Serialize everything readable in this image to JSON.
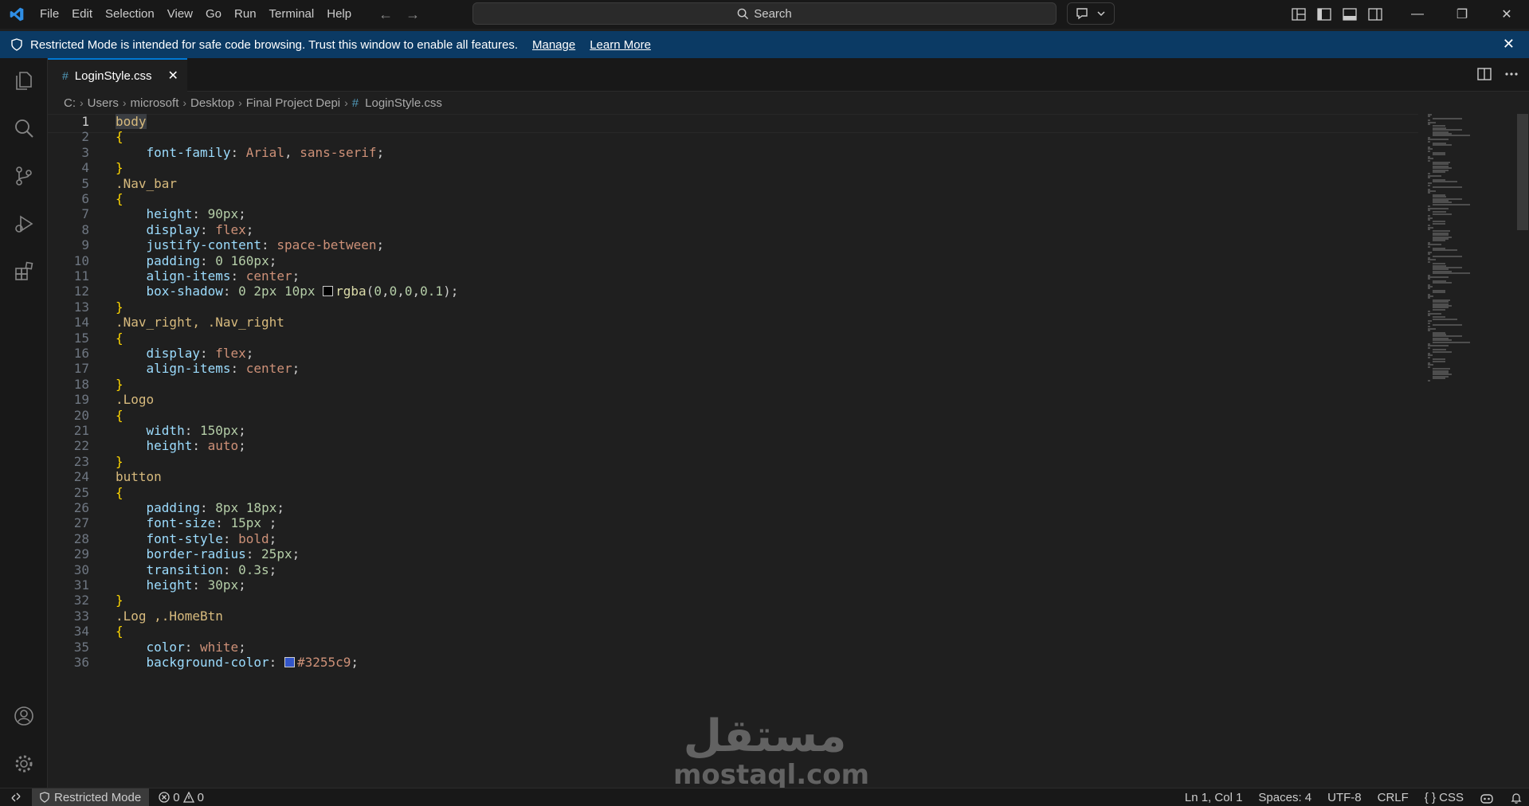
{
  "menu": [
    "File",
    "Edit",
    "Selection",
    "View",
    "Go",
    "Run",
    "Terminal",
    "Help"
  ],
  "search": {
    "label": "Search"
  },
  "banner": {
    "message": "Restricted Mode is intended for safe code browsing. Trust this window to enable all features.",
    "manage": "Manage",
    "learn_more": "Learn More"
  },
  "tab": {
    "hash": "#",
    "title": "LoginStyle.css"
  },
  "breadcrumb": [
    "C:",
    "Users",
    "microsoft",
    "Desktop",
    "Final Project Depi",
    "LoginStyle.css"
  ],
  "editor": {
    "lines": [
      {
        "n": "1",
        "text": "body"
      },
      {
        "n": "2",
        "text": "{"
      },
      {
        "n": "3",
        "text": "    font-family: Arial, sans-serif;"
      },
      {
        "n": "4",
        "text": "}"
      },
      {
        "n": "5",
        "text": ".Nav_bar"
      },
      {
        "n": "6",
        "text": "{"
      },
      {
        "n": "7",
        "text": "    height: 90px;"
      },
      {
        "n": "8",
        "text": "    display: flex;"
      },
      {
        "n": "9",
        "text": "    justify-content: space-between;"
      },
      {
        "n": "10",
        "text": "    padding: 0 160px;"
      },
      {
        "n": "11",
        "text": "    align-items: center;"
      },
      {
        "n": "12",
        "text": "    box-shadow: 0 2px 10px rgba(0,0,0,0.1);"
      },
      {
        "n": "13",
        "text": "}"
      },
      {
        "n": "14",
        "text": ".Nav_right, .Nav_right"
      },
      {
        "n": "15",
        "text": "{"
      },
      {
        "n": "16",
        "text": "    display: flex;"
      },
      {
        "n": "17",
        "text": "    align-items: center;"
      },
      {
        "n": "18",
        "text": "}"
      },
      {
        "n": "19",
        "text": ".Logo"
      },
      {
        "n": "20",
        "text": "{"
      },
      {
        "n": "21",
        "text": "    width: 150px;"
      },
      {
        "n": "22",
        "text": "    height: auto;"
      },
      {
        "n": "23",
        "text": "}"
      },
      {
        "n": "24",
        "text": "button"
      },
      {
        "n": "25",
        "text": "{"
      },
      {
        "n": "26",
        "text": "    padding: 8px 18px;"
      },
      {
        "n": "27",
        "text": "    font-size: 15px ;"
      },
      {
        "n": "28",
        "text": "    font-style: bold;"
      },
      {
        "n": "29",
        "text": "    border-radius: 25px;"
      },
      {
        "n": "30",
        "text": "    transition: 0.3s;"
      },
      {
        "n": "31",
        "text": "    height: 30px;"
      },
      {
        "n": "32",
        "text": "}"
      },
      {
        "n": "33",
        "text": ".Log ,.HomeBtn"
      },
      {
        "n": "34",
        "text": "{"
      },
      {
        "n": "35",
        "text": "    color: white;"
      },
      {
        "n": "36",
        "text": "    background-color: #3255c9;"
      }
    ],
    "swatch_colors": {
      "shadow": "#000000",
      "blue": "#3255c9"
    }
  },
  "watermark": {
    "arabic": "مستقل",
    "latin": "mostaql.com"
  },
  "status": {
    "restricted": "Restricted Mode",
    "errors": "0",
    "warnings": "0",
    "position": "Ln 1, Col 1",
    "spaces": "Spaces: 4",
    "encoding": "UTF-8",
    "eol": "CRLF",
    "language": "CSS",
    "language_icon": "{ }"
  },
  "colors": {
    "accent": "#0078d4",
    "banner": "#0b3a64"
  }
}
